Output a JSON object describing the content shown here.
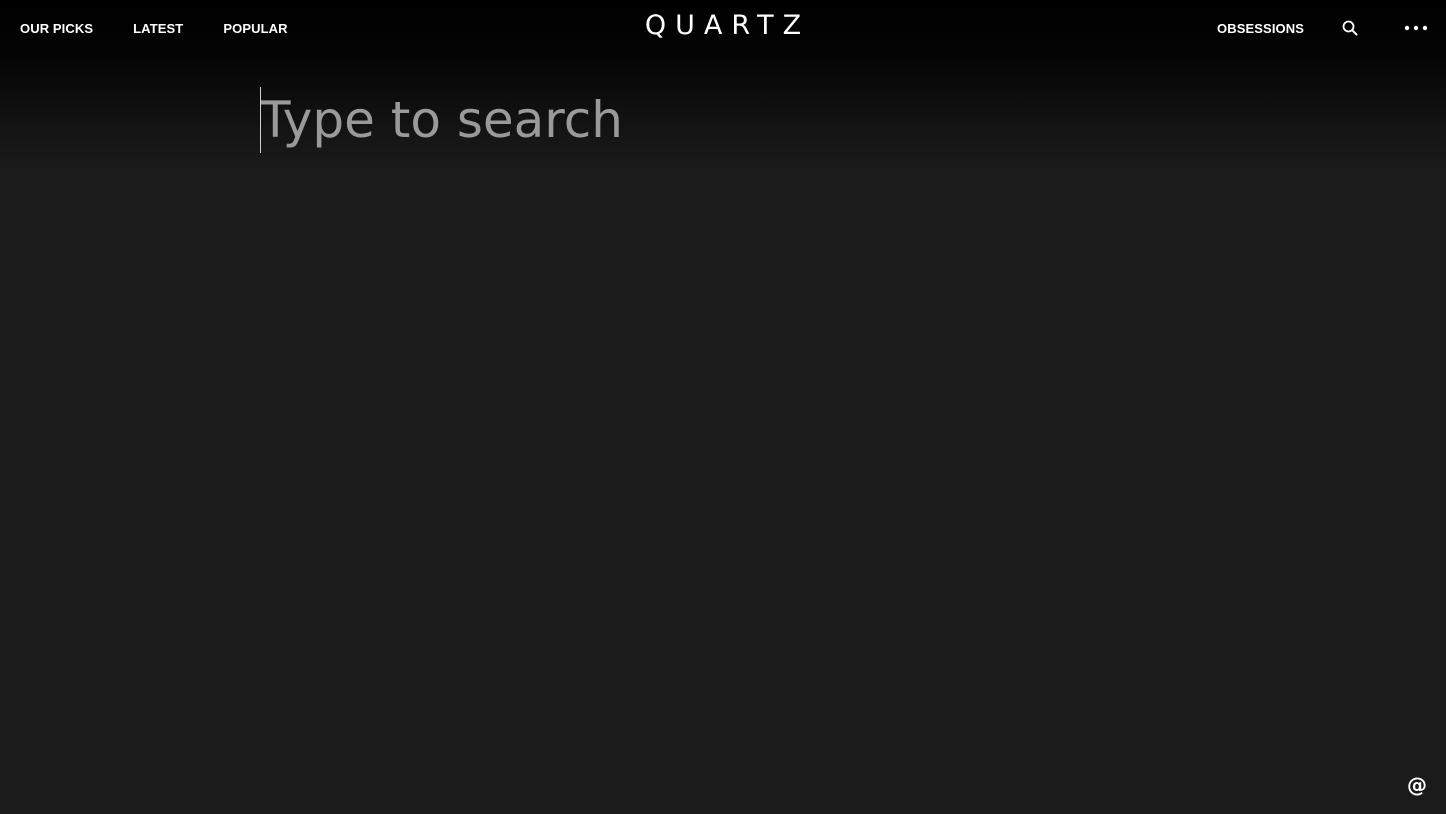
{
  "nav_left": [
    {
      "label": "OUR PICKS"
    },
    {
      "label": "LATEST"
    },
    {
      "label": "POPULAR"
    }
  ],
  "logo": "QUARTZ",
  "nav_right": {
    "obsessions_label": "OBSESSIONS",
    "search_icon": "search-icon",
    "more_icon": "more-horizontal-icon"
  },
  "search": {
    "value": "",
    "placeholder": "Type to search"
  },
  "floating": {
    "at_symbol": "@"
  },
  "colors": {
    "background": "#1b1b1b",
    "header": "#000000",
    "text": "#ffffff",
    "placeholder": "#9a9a9a"
  }
}
